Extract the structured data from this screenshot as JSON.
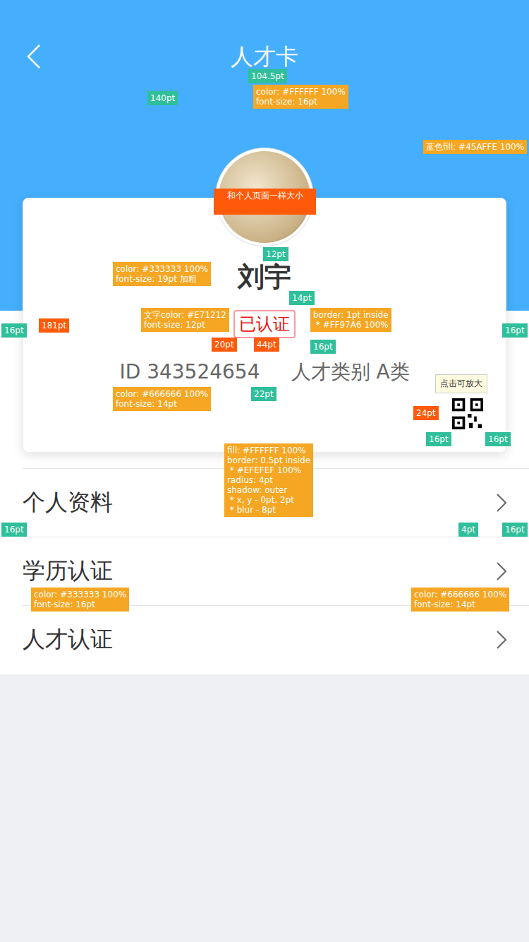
{
  "nav": {
    "title": "人才卡"
  },
  "card": {
    "name": "刘宇",
    "badge": "已认证",
    "id": "ID 343524654",
    "category": "人才类别 A类",
    "qr_hint": "点击可放大"
  },
  "menu": [
    {
      "label": "个人资料"
    },
    {
      "label": "学历认证"
    },
    {
      "label": "人才认证"
    }
  ],
  "annotations": {
    "title-gap": {
      "kind": "measure",
      "lines": [
        "104.5pt"
      ]
    },
    "title-spec": {
      "kind": "spec",
      "lines": [
        "color: #FFFFFF 100%",
        "font-size: 16pt"
      ]
    },
    "header-height": {
      "kind": "measure",
      "lines": [
        "140pt"
      ]
    },
    "blue-spec": {
      "kind": "spec",
      "lines": [
        "蓝色fill: #45AFFE 100%"
      ]
    },
    "avatar-note": {
      "kind": "alert",
      "lines": [
        "和个人页面一样大小"
      ]
    },
    "avatar-gap": {
      "kind": "measure",
      "lines": [
        "12pt"
      ]
    },
    "name-spec": {
      "kind": "spec",
      "lines": [
        "color: #333333 100%",
        "font-size: 19pt 加粗"
      ]
    },
    "name-gap": {
      "kind": "measure",
      "lines": [
        "14pt"
      ]
    },
    "badge-spec": {
      "kind": "spec",
      "lines": [
        "文字color: #E71212",
        "font-size: 12pt"
      ]
    },
    "badge-height": {
      "kind": "alert",
      "lines": [
        "20pt"
      ]
    },
    "badge-width": {
      "kind": "alert",
      "lines": [
        "44pt"
      ]
    },
    "border-spec": {
      "kind": "spec",
      "lines": [
        "border: 1pt inside",
        " * #FF97A6 100%"
      ]
    },
    "badge-gap": {
      "kind": "measure",
      "lines": [
        "16pt"
      ]
    },
    "card-height": {
      "kind": "alert",
      "lines": [
        "181pt"
      ]
    },
    "card-left": {
      "kind": "measure",
      "lines": [
        "16pt"
      ]
    },
    "card-right": {
      "kind": "measure",
      "lines": [
        "16pt"
      ]
    },
    "id-spec": {
      "kind": "spec",
      "lines": [
        "color: #666666 100%",
        "font-size: 14pt"
      ]
    },
    "id-gap": {
      "kind": "measure",
      "lines": [
        "22pt"
      ]
    },
    "qr-size": {
      "kind": "alert",
      "lines": [
        "24pt"
      ]
    },
    "qr-right": {
      "kind": "measure",
      "lines": [
        "16pt"
      ]
    },
    "qr-bottom": {
      "kind": "measure",
      "lines": [
        "16pt"
      ]
    },
    "card-spec": {
      "kind": "spec",
      "lines": [
        "fill: #FFFFFF 100%",
        "border: 0.5pt inside",
        " * #EFEFEF 100%",
        "radius: 4pt",
        "shadow: outer",
        " * x, y - 0pt, 2pt",
        " * blur - 8pt"
      ]
    },
    "menu-left": {
      "kind": "measure",
      "lines": [
        "16pt"
      ]
    },
    "arrow-gap": {
      "kind": "measure",
      "lines": [
        "4pt"
      ]
    },
    "menu-right": {
      "kind": "measure",
      "lines": [
        "16pt"
      ]
    },
    "menu-spec": {
      "kind": "spec",
      "lines": [
        "color: #333333 100%",
        "font-size: 16pt"
      ]
    },
    "arrow-spec": {
      "kind": "spec",
      "lines": [
        "color: #666666 100%",
        "font-size: 14pt"
      ]
    }
  }
}
